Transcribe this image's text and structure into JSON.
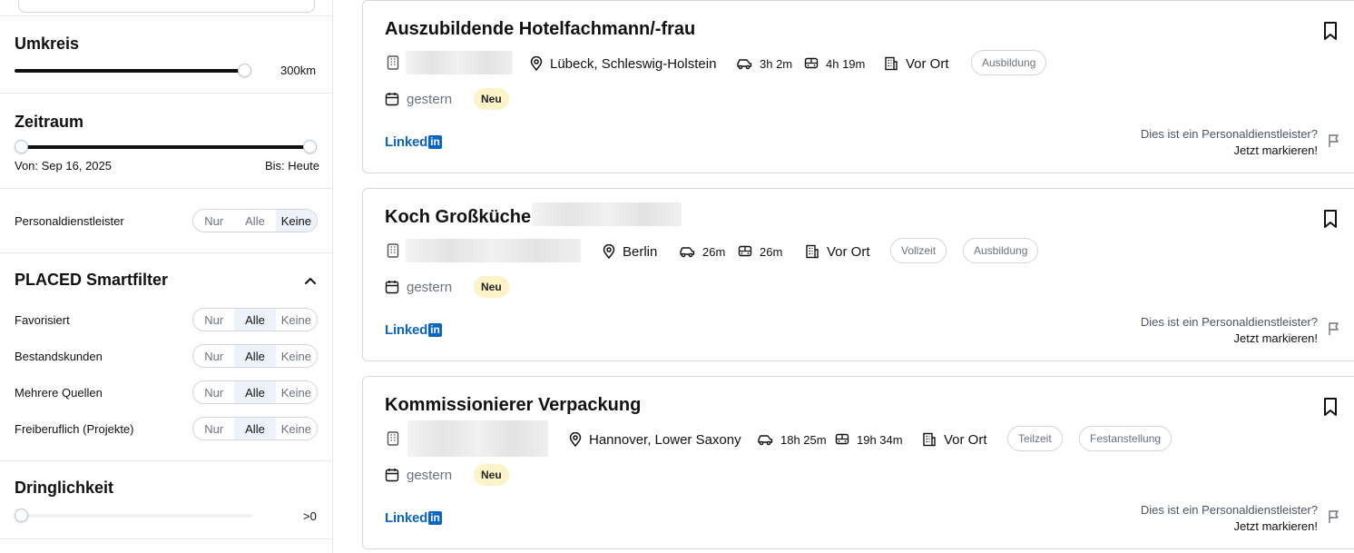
{
  "sidebar": {
    "umkreis": {
      "title": "Umkreis",
      "value": "300km",
      "level": 1.0
    },
    "zeitraum": {
      "title": "Zeitraum",
      "from": "Von: Sep 16, 2025",
      "to": "Bis: Heute"
    },
    "personaldienstleister": {
      "label": "Personaldienstleister",
      "options": [
        "Nur",
        "Alle",
        "Keine"
      ],
      "selected": "Keine"
    },
    "smartfilter": {
      "title": "PLACED Smartfilter",
      "rows": [
        {
          "label": "Favorisiert",
          "selected": "Alle"
        },
        {
          "label": "Bestandskunden",
          "selected": "Alle"
        },
        {
          "label": "Mehrere Quellen",
          "selected": "Alle"
        },
        {
          "label": "Freiberuflich (Projekte)",
          "selected": "Alle"
        }
      ],
      "options": [
        "Nur",
        "Alle",
        "Keine"
      ]
    },
    "dringlichkeit": {
      "title": "Dringlichkeit",
      "value": ">0",
      "level": 0.0
    }
  },
  "jobs": [
    {
      "title": "Auszubildende Hotelfachmann/-frau",
      "location": "Lübeck, Schleswig-Holstein",
      "car_time": "3h 2m",
      "transit_time": "4h 19m",
      "work_mode": "Vor Ort",
      "tags": [
        "Ausbildung"
      ],
      "date": "gestern",
      "badge": "Neu",
      "source": "LinkedIn"
    },
    {
      "title": "Koch Großküche",
      "location": "Berlin",
      "car_time": "26m",
      "transit_time": "26m",
      "work_mode": "Vor Ort",
      "tags": [
        "Vollzeit",
        "Ausbildung"
      ],
      "date": "gestern",
      "badge": "Neu",
      "source": "LinkedIn"
    },
    {
      "title": "Kommissionierer Verpackung",
      "location": "Hannover, Lower Saxony",
      "car_time": "18h 25m",
      "transit_time": "19h 34m",
      "work_mode": "Vor Ort",
      "tags": [
        "Teilzeit",
        "Festanstellung"
      ],
      "date": "gestern",
      "badge": "Neu",
      "source": "LinkedIn"
    }
  ],
  "report": {
    "question": "Dies ist ein Personaldienstleister?",
    "action": "Jetzt markieren!"
  },
  "linkedin": {
    "text": "Linked",
    "box": "in"
  },
  "colors": {
    "accent": "#0a66c2",
    "badge_bg": "#fdf3c8",
    "segment_active": "#eef2fb"
  }
}
